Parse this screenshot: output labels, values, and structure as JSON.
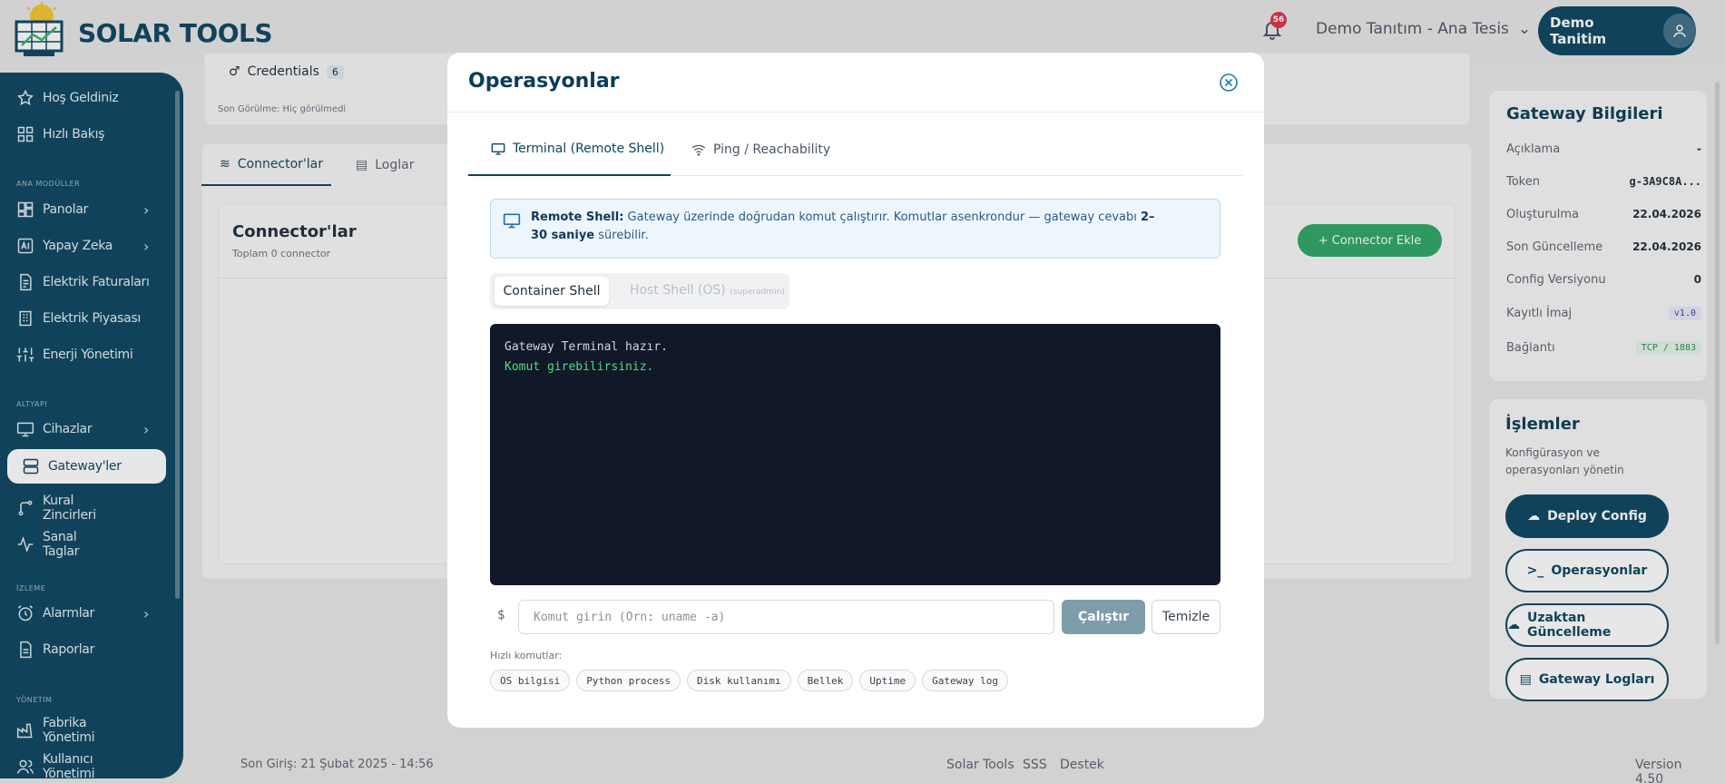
{
  "app": {
    "brand": "SOLAR TOOLS"
  },
  "header": {
    "notification_count": "56",
    "tenant": "Demo Tanıtım - Ana Tesis",
    "user": "Demo Tanitim"
  },
  "sidebar": {
    "items": [
      {
        "label": "Hoş Geldiniz",
        "icon": "star-icon"
      },
      {
        "label": "Hızlı Bakış",
        "icon": "grid-icon"
      },
      {
        "label": "Panolar",
        "icon": "dashboard-icon"
      },
      {
        "label": "Yapay Zeka",
        "icon": "ai-icon"
      },
      {
        "label": "Elektrik Faturaları",
        "icon": "invoice-icon"
      },
      {
        "label": "Elektrik Piyasası",
        "icon": "building-icon"
      },
      {
        "label": "Enerji Yönetimi",
        "icon": "sliders-icon"
      },
      {
        "label": "Cihazlar",
        "icon": "monitor-icon"
      },
      {
        "label": "Gateway'ler",
        "icon": "server-icon"
      },
      {
        "label": "Kural Zincirleri",
        "icon": "flow-icon"
      },
      {
        "label": "Sanal Taglar",
        "icon": "pulse-icon"
      },
      {
        "label": "Alarmlar",
        "icon": "alarm-icon"
      },
      {
        "label": "Raporlar",
        "icon": "report-icon"
      },
      {
        "label": "Fabrika Yönetimi",
        "icon": "factory-icon"
      },
      {
        "label": "Kullanıcı Yönetimi",
        "icon": "users-icon"
      }
    ],
    "sections": {
      "ana": "ANA MODÜLLER",
      "altyapi": "ALTYAPI",
      "izleme": "İZLEME",
      "yonetim": "YÖNETİM"
    }
  },
  "background": {
    "credentials_label": "Credentials",
    "credentials_count": "6",
    "last_seen": "Son Görülme: Hiç görülmedi",
    "tabs": [
      "Connector'lar",
      "Loglar"
    ],
    "connectors_title": "Connector'lar",
    "connectors_sub": "Toplam 0 connector",
    "add_connector": "+ Connector Ekle"
  },
  "gateway_info": {
    "title": "Gateway Bilgileri",
    "rows": [
      {
        "k": "Açıklama",
        "v": "-"
      },
      {
        "k": "Token",
        "v": "g-3A9C8A..."
      },
      {
        "k": "Oluşturulma",
        "v": "22.04.2026"
      },
      {
        "k": "Son Güncelleme",
        "v": "22.04.2026"
      },
      {
        "k": "Config Versiyonu",
        "v": "0"
      },
      {
        "k": "Kayıtlı İmaj",
        "v": "v1.0"
      },
      {
        "k": "Bağlantı",
        "v": "TCP / 1883"
      }
    ]
  },
  "islemler": {
    "title": "İşlemler",
    "desc": "Konfigürasyon ve operasyonları yönetin",
    "buttons": [
      "Deploy Config",
      "Operasyonlar",
      "Uzaktan Güncelleme",
      "Gateway Logları"
    ]
  },
  "footer": {
    "last_login": "Son Giriş: 21 Şubat 2025 - 14:56",
    "links": [
      "Solar Tools",
      "SSS",
      "Destek"
    ],
    "version": "Version 4.50"
  },
  "modal": {
    "title": "Operasyonlar",
    "tabs": [
      "Terminal (Remote Shell)",
      "Ping / Reachability"
    ],
    "info_bold": "Remote Shell:",
    "info_text": " Gateway üzerinde doğrudan komut çalıştırır. Komutlar asenkrondur — gateway cevabı ",
    "info_bold2": "2–30 saniye",
    "info_tail": " sürebilir.",
    "shell_tabs": {
      "container": "Container Shell",
      "host": "Host Shell (OS)",
      "host_note": "(superadmin)"
    },
    "terminal_lines": [
      "Gateway Terminal hazır.",
      "Komut girebilirsiniz."
    ],
    "prompt": "$",
    "command_placeholder": "Komut girin (Örn: uname -a)",
    "command_value": "",
    "run": "Çalıştır",
    "clear": "Temizle",
    "quick_label": "Hızlı komutlar:",
    "quick": [
      "OS bilgisi",
      "Python process",
      "Disk kullanımı",
      "Bellek",
      "Uptime",
      "Gateway log"
    ]
  }
}
